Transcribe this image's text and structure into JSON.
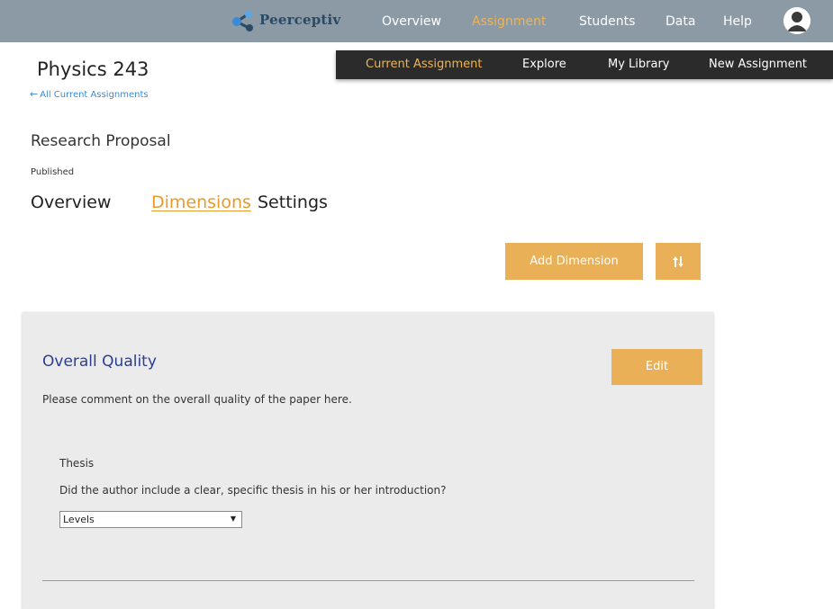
{
  "brand": {
    "name": "Peerceptiv",
    "logo_icon": "peerceptiv-logo-icon"
  },
  "topnav": {
    "items": [
      {
        "label": "Overview"
      },
      {
        "label": "Assignment"
      },
      {
        "label": "Students"
      },
      {
        "label": "Data"
      },
      {
        "label": "Help"
      }
    ],
    "active": "Assignment",
    "avatar_icon": "user-avatar-icon"
  },
  "subnav": {
    "items": [
      {
        "label": "Current Assignment"
      },
      {
        "label": "Explore"
      },
      {
        "label": "My Library"
      },
      {
        "label": "New Assignment"
      }
    ],
    "active": "Current Assignment"
  },
  "course": {
    "title": "Physics 243",
    "back_link": "All Current Assignments"
  },
  "assignment": {
    "title": "Research Proposal",
    "status": "Published"
  },
  "tabs": {
    "items": [
      {
        "label": "Overview"
      },
      {
        "label": "Dimensions"
      },
      {
        "label": "Settings"
      }
    ],
    "active": "Dimensions"
  },
  "toolbar": {
    "add_dimension_label": "Add Dimension",
    "sort_icon": "sort-arrows-icon"
  },
  "dimension": {
    "title": "Overall Quality",
    "edit_label": "Edit",
    "description": "Please comment on the overall quality of the paper here.",
    "criterion": {
      "name": "Thesis",
      "question": "Did the author include a clear, specific thesis in his or her introduction?",
      "type_selected": "Levels"
    }
  },
  "colors": {
    "topbar_bg": "#8c9aa5",
    "subnav_bg": "#2b2b2b",
    "accent_orange": "#eab058",
    "active_text": "#f0b354",
    "tab_active": "#e89a2c",
    "dimension_title": "#2c3e8f",
    "link_blue": "#3a8ad6",
    "card_bg": "#ebebeb"
  }
}
